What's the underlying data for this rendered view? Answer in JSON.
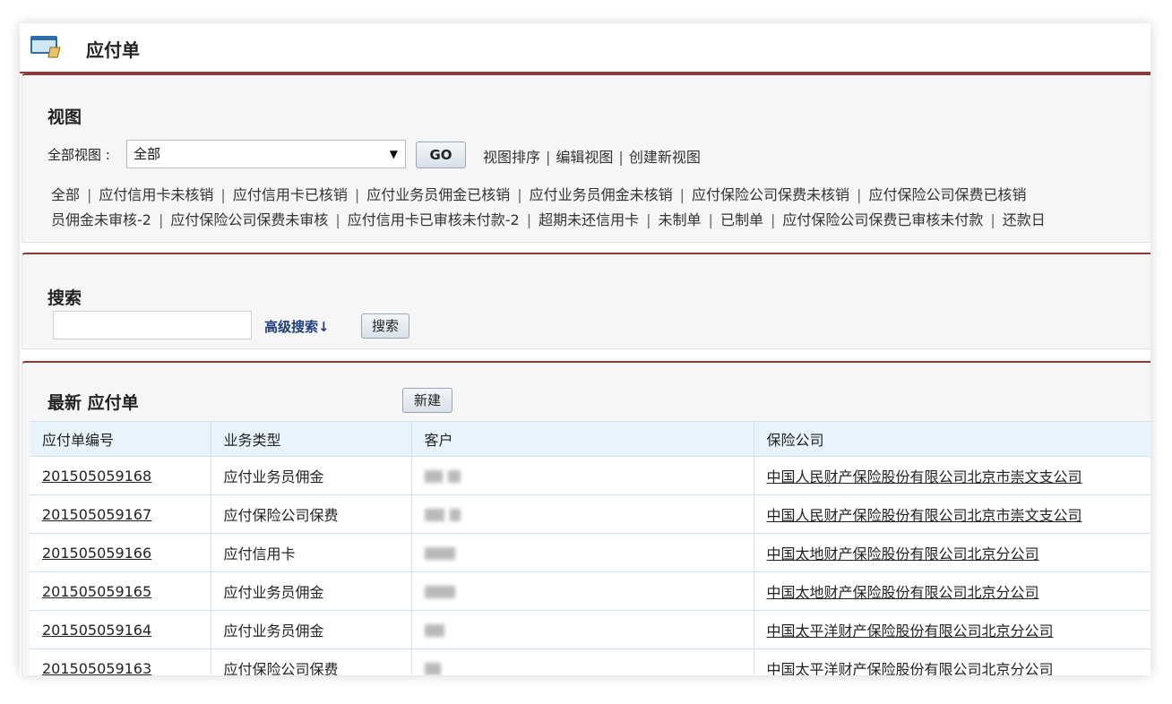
{
  "header": {
    "title": "应付单",
    "icon": "folder-window-icon"
  },
  "view_section": {
    "title": "视图",
    "label": "全部视图 :",
    "selected": "全部",
    "go_label": "GO",
    "links": [
      "视图排序",
      "编辑视图",
      "创建新视图"
    ],
    "filters_line1": [
      "全部",
      "应付信用卡未核销",
      "应付信用卡已核销",
      "应付业务员佣金已核销",
      "应付业务员佣金未核销",
      "应付保险公司保费未核销",
      "应付保险公司保费已核销"
    ],
    "filters_line2": [
      "员佣金未审核-2",
      "应付保险公司保费未审核",
      "应付信用卡已审核未付款-2",
      "超期未还信用卡",
      "未制单",
      "已制单",
      "应付保险公司保费已审核未付款",
      "还款日"
    ]
  },
  "search_section": {
    "title": "搜索",
    "input_value": "",
    "advanced_label": "高级搜索↓",
    "button_label": "搜索"
  },
  "recent_section": {
    "title": "最新 应付单",
    "new_label": "新建",
    "columns": [
      "应付单编号",
      "业务类型",
      "客户",
      "保险公司"
    ],
    "rows": [
      {
        "id": "201505059168",
        "type": "应付业务员佣金",
        "company": "中国人民财产保险股份有限公司北京市崇文支公司"
      },
      {
        "id": "201505059167",
        "type": "应付保险公司保费",
        "company": "中国人民财产保险股份有限公司北京市崇文支公司"
      },
      {
        "id": "201505059166",
        "type": "应付信用卡",
        "company": "中国太地财产保险股份有限公司北京分公司"
      },
      {
        "id": "201505059165",
        "type": "应付业务员佣金",
        "company": "中国太地财产保险股份有限公司北京分公司"
      },
      {
        "id": "201505059164",
        "type": "应付业务员佣金",
        "company": "中国太平洋财产保险股份有限公司北京分公司"
      },
      {
        "id": "201505059163",
        "type": "应付保险公司保费",
        "company": "中国太平洋财产保险股份有限公司北京分公司"
      }
    ]
  },
  "colors": {
    "accent_border": "#8a3a3a",
    "table_header_bg": "#e9f3fb",
    "link_blue": "#1f3f7a"
  }
}
